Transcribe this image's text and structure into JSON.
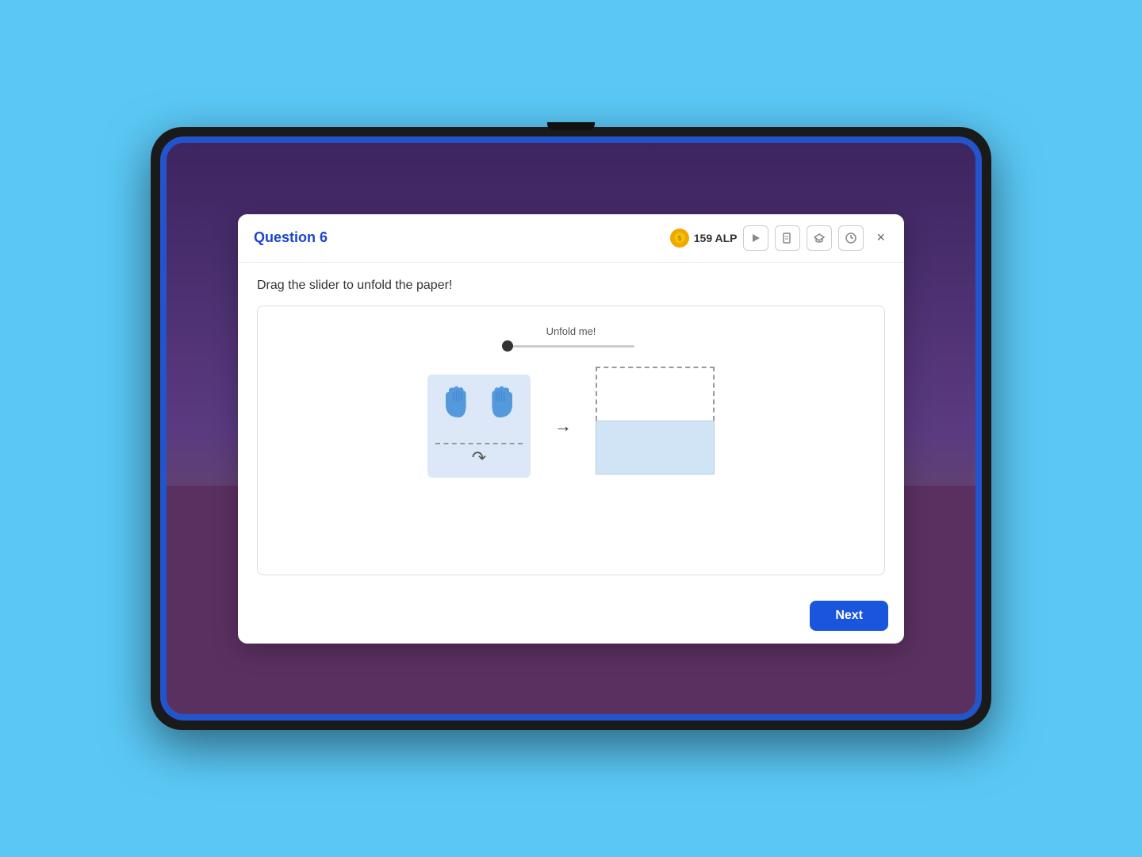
{
  "tablet": {
    "camera_label": "camera"
  },
  "modal": {
    "title": "Question 6",
    "alp_amount": "159 ALP",
    "instruction": "Drag the slider to unfold the paper!",
    "unfold_label": "Unfold me!",
    "slider_value": 0,
    "next_button": "Next"
  },
  "header_buttons": [
    {
      "name": "play-button",
      "icon": "▶"
    },
    {
      "name": "document-button",
      "icon": "📄"
    },
    {
      "name": "graduation-button",
      "icon": "🎓"
    },
    {
      "name": "clock-button",
      "icon": "⏱"
    }
  ],
  "icons": {
    "coin": "🪙",
    "close": "×",
    "arrow_right": "→",
    "fold_arrow": "↷"
  }
}
